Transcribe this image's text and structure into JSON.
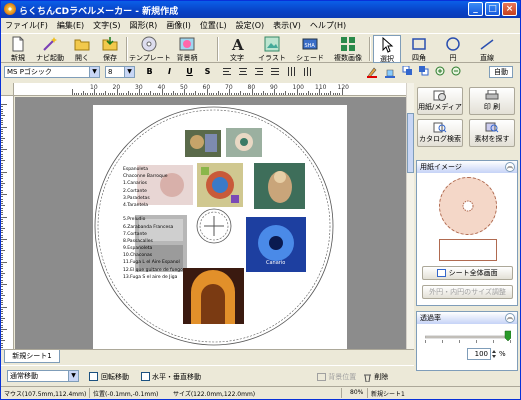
{
  "window": {
    "title": "らくちんCDラベルメーカー - 新規作成",
    "controls": {
      "minimize": "_",
      "maximize": "□",
      "close": "×"
    }
  },
  "menu": [
    "ファイル(F)",
    "編集(E)",
    "文字(S)",
    "図形(R)",
    "画像(I)",
    "位置(L)",
    "設定(O)",
    "表示(V)",
    "ヘルプ(H)"
  ],
  "toolbar": {
    "new": "新規",
    "navi": "ナビ起動",
    "open": "開く",
    "save": "保存",
    "template": "テンプレート",
    "background": "背景柄",
    "text": "文字",
    "illust": "イラスト",
    "shade": "シェード",
    "multi_image": "複数画像",
    "select": "選択",
    "rect": "四角",
    "circle": "円",
    "line": "直線"
  },
  "format": {
    "font": "MS Pゴシック",
    "size": "8",
    "bold": "B",
    "italic": "I",
    "underline": "U",
    "strike": "S",
    "auto": "自動"
  },
  "ruler": {
    "labels": [
      "10",
      "20",
      "30",
      "40",
      "50",
      "60",
      "70",
      "80",
      "90",
      "100",
      "110",
      "120"
    ]
  },
  "label": {
    "tracks": [
      "Espanoleta",
      "Chaconne Barroque",
      "1.Canarios",
      "2.Cortante",
      "3.Paradetas",
      "4.Tarantela",
      "",
      "5.Preludio",
      "6.Zarabanda Francesa",
      "7.Cortante",
      "8.Passacalles",
      "9.Espanoleta",
      "10.Chaconas",
      "11.Fuga L el Aire Espanol",
      "12.El que guitare de fuego",
      "13.Fuga S el aire de Jiga"
    ],
    "album_text": "Canario"
  },
  "sheet": {
    "tab": "新規シート1"
  },
  "bottom": {
    "mode": "通常移動",
    "rotate": "回転移動",
    "hv": "水平・垂直移動",
    "bgpos": "背景位置",
    "delete": "削除"
  },
  "status": {
    "mouse": "マウス(107.5mm,112.4mm)",
    "position": "位置(-0.1mm,-0.1mm)",
    "size": "サイズ(122.0mm,122.0mm)",
    "zoom": "80%",
    "sheet": "新規シート1"
  },
  "panel": {
    "paper_media": "用紙/メディア",
    "print": "印 刷",
    "catalog": "カタログ検索",
    "material": "素材を探す",
    "paper_image_title": "用紙イメージ",
    "sheet_full": "シート全体画面",
    "adjust": "外円・内円のサイズ調整",
    "transparency_title": "透過率",
    "transparency_value": "100",
    "transparency_unit": "%"
  },
  "colors": {
    "title_bar": "#0842c6",
    "accent": "#7f9db9",
    "panel_bg": "#ece9d8"
  }
}
